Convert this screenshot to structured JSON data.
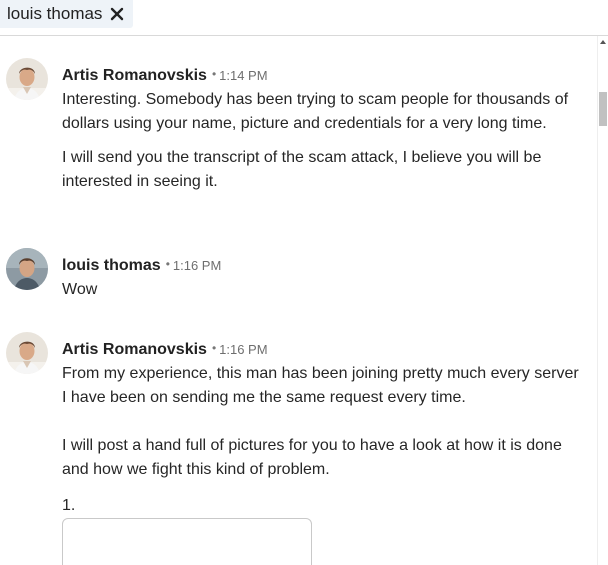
{
  "recipient": {
    "name": "louis thomas",
    "close_icon": "close-icon"
  },
  "messages": [
    {
      "sender": "Artis Romanovskis",
      "separator": "•",
      "time": "1:14 PM",
      "paragraphs": [
        "Interesting. Somebody has been trying to scam people for thousands of dollars using your name, picture and credentials for a very long time.",
        "I will send you the transcript of the scam attack, I believe you will be interested in seeing it."
      ]
    },
    {
      "sender": "louis thomas",
      "separator": "•",
      "time": "1:16 PM",
      "paragraphs": [
        "Wow"
      ]
    },
    {
      "sender": "Artis Romanovskis",
      "separator": "•",
      "time": "1:16 PM",
      "paragraphs": [
        "From my experience, this man has been joining pretty much every server I have been on sending me the same request every time.",
        "I will post a hand full of pictures for you to have a look at how it is done and how we fight this kind of problem.",
        "1."
      ]
    }
  ],
  "colors": {
    "chip_background": "#eef3f8",
    "text": "#222222",
    "timestamp": "#6e6e6e"
  }
}
